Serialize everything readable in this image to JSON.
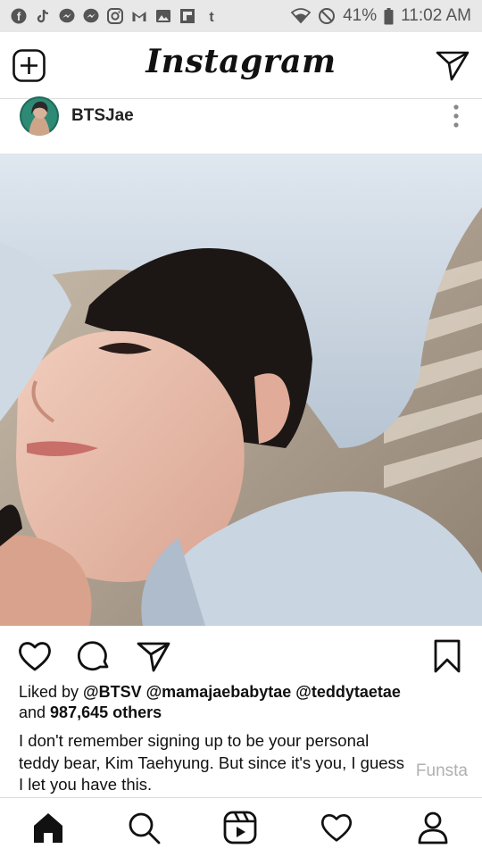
{
  "status_bar": {
    "battery": "41%",
    "time": "11:02 AM",
    "left_icons": [
      "facebook-icon",
      "tiktok-icon",
      "messenger-icon",
      "messenger-icon",
      "instagram-icon",
      "gmail-icon",
      "gallery-icon",
      "flipboard-icon",
      "tumblr-icon"
    ],
    "right_icons": [
      "wifi-icon",
      "do-not-disturb-icon",
      "battery-icon"
    ]
  },
  "header": {
    "logo": "Instagram"
  },
  "post": {
    "username": "BTSJae",
    "likes_prefix": "Liked by ",
    "liked_by_1": "@BTSV",
    "liked_by_2": "@mamajaebabytae",
    "liked_by_3": "@teddytaetae",
    "and_text": "and ",
    "others_count": "987,645 others",
    "caption": "I don't remember signing up to be your personal teddy bear,  Kim Taehyung.  But since it's you, I guess I let you have this.",
    "watermark": "Funsta"
  },
  "colors": {
    "status_bar_bg": "#e8e8e8",
    "text": "#111111",
    "watermark": "#b0b0b0"
  }
}
